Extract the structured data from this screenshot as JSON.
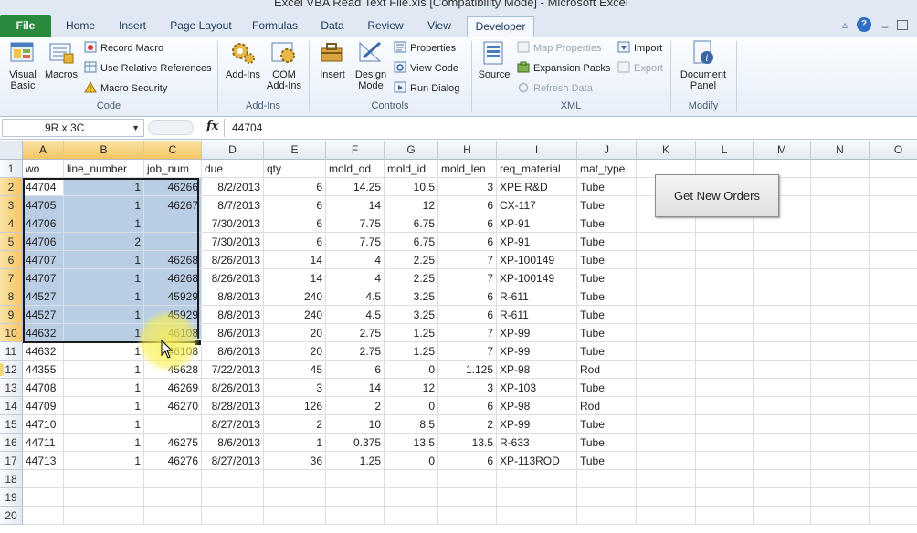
{
  "window": {
    "title": "Excel VBA Read Text File.xls  [Compatibility Mode]  -  Microsoft Excel"
  },
  "ribbon_tabs": [
    {
      "label": "File",
      "active": false
    },
    {
      "label": "Home",
      "active": false
    },
    {
      "label": "Insert",
      "active": false
    },
    {
      "label": "Page Layout",
      "active": false
    },
    {
      "label": "Formulas",
      "active": false
    },
    {
      "label": "Data",
      "active": false
    },
    {
      "label": "Review",
      "active": false
    },
    {
      "label": "View",
      "active": false
    },
    {
      "label": "Developer",
      "active": true
    }
  ],
  "ribbon": {
    "code": {
      "label": "Code",
      "visual_basic": "Visual Basic",
      "macros": "Macros",
      "record_macro": "Record Macro",
      "relative_refs": "Use Relative References",
      "macro_security": "Macro Security"
    },
    "addins": {
      "label": "Add-Ins",
      "addins": "Add-Ins",
      "com_addins": "COM Add-Ins"
    },
    "controls": {
      "label": "Controls",
      "insert": "Insert",
      "design_mode": "Design Mode",
      "properties": "Properties",
      "view_code": "View Code",
      "run_dialog": "Run Dialog"
    },
    "xml": {
      "label": "XML",
      "source": "Source",
      "map_properties": "Map Properties",
      "expansion_packs": "Expansion Packs",
      "refresh_data": "Refresh Data",
      "import": "Import",
      "export": "Export"
    },
    "modify": {
      "label": "Modify",
      "document_panel": "Document Panel"
    }
  },
  "formula_bar": {
    "name_box": "9R x 3C",
    "fx": "fx",
    "value": "44704"
  },
  "sheet": {
    "columns": [
      "A",
      "B",
      "C",
      "D",
      "E",
      "F",
      "G",
      "H",
      "I",
      "J",
      "K",
      "L",
      "M",
      "N",
      "O"
    ],
    "selected_columns": [
      "A",
      "B",
      "C"
    ],
    "row_numbers": [
      "1",
      "2",
      "3",
      "4",
      "5",
      "6",
      "7",
      "8",
      "9",
      "10",
      "11",
      "12",
      "13",
      "14",
      "15",
      "16",
      "17",
      "18",
      "19",
      "20"
    ],
    "selected_rows": [
      "2",
      "3",
      "4",
      "5",
      "6",
      "7",
      "8",
      "9",
      "10"
    ],
    "header": [
      "wo",
      "line_number",
      "job_num",
      "due",
      "qty",
      "mold_od",
      "mold_id",
      "mold_len",
      "req_material",
      "mat_type"
    ],
    "rows": [
      [
        "44704",
        "1",
        "46266",
        "8/2/2013",
        "6",
        "14.25",
        "10.5",
        "3",
        "XPE R&D",
        "Tube"
      ],
      [
        "44705",
        "1",
        "46267",
        "8/7/2013",
        "6",
        "14",
        "12",
        "6",
        "CX-117",
        "Tube"
      ],
      [
        "44706",
        "1",
        "",
        "7/30/2013",
        "6",
        "7.75",
        "6.75",
        "6",
        "XP-91",
        "Tube"
      ],
      [
        "44706",
        "2",
        "",
        "7/30/2013",
        "6",
        "7.75",
        "6.75",
        "6",
        "XP-91",
        "Tube"
      ],
      [
        "44707",
        "1",
        "46268",
        "8/26/2013",
        "14",
        "4",
        "2.25",
        "7",
        "XP-100149",
        "Tube"
      ],
      [
        "44707",
        "1",
        "46268",
        "8/26/2013",
        "14",
        "4",
        "2.25",
        "7",
        "XP-100149",
        "Tube"
      ],
      [
        "44527",
        "1",
        "45929",
        "8/8/2013",
        "240",
        "4.5",
        "3.25",
        "6",
        "R-611",
        "Tube"
      ],
      [
        "44527",
        "1",
        "45929",
        "8/8/2013",
        "240",
        "4.5",
        "3.25",
        "6",
        "R-611",
        "Tube"
      ],
      [
        "44632",
        "1",
        "46108",
        "8/6/2013",
        "20",
        "2.75",
        "1.25",
        "7",
        "XP-99",
        "Tube"
      ],
      [
        "44632",
        "1",
        "46108",
        "8/6/2013",
        "20",
        "2.75",
        "1.25",
        "7",
        "XP-99",
        "Tube"
      ],
      [
        "44355",
        "1",
        "45628",
        "7/22/2013",
        "45",
        "6",
        "0",
        "1.125",
        "XP-98",
        "Rod"
      ],
      [
        "44708",
        "1",
        "46269",
        "8/26/2013",
        "3",
        "14",
        "12",
        "3",
        "XP-103",
        "Tube"
      ],
      [
        "44709",
        "1",
        "46270",
        "8/28/2013",
        "126",
        "2",
        "0",
        "6",
        "XP-98",
        "Rod"
      ],
      [
        "44710",
        "1",
        "",
        "8/27/2013",
        "2",
        "10",
        "8.5",
        "2",
        "XP-99",
        "Tube"
      ],
      [
        "44711",
        "1",
        "46275",
        "8/6/2013",
        "1",
        "0.375",
        "13.5",
        "13.5",
        "R-633",
        "Tube"
      ],
      [
        "44713",
        "1",
        "46276",
        "8/27/2013",
        "36",
        "1.25",
        "0",
        "6",
        "XP-113ROD",
        "Tube"
      ]
    ],
    "button_label": "Get New Orders"
  },
  "colors": {
    "file_tab": "#2a8a3b",
    "selection": "#b9cde5",
    "selected_header": "#f5c662"
  }
}
